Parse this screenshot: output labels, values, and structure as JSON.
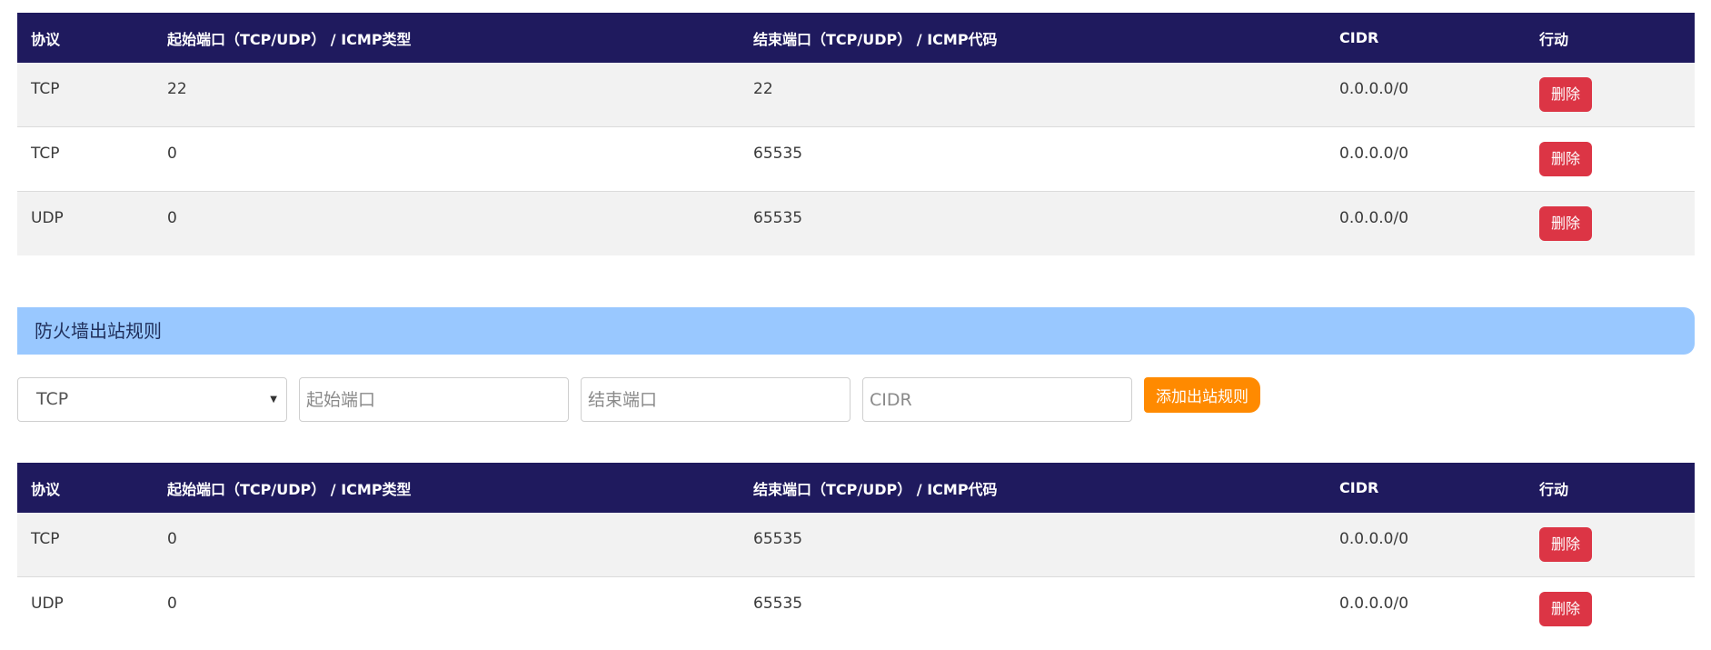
{
  "columns": [
    "协议",
    "起始端口（TCP/UDP） / ICMP类型",
    "结束端口（TCP/UDP） / ICMP代码",
    "CIDR",
    "行动"
  ],
  "inbound_rules": [
    {
      "protocol": "TCP",
      "start": "22",
      "end": "22",
      "cidr": "0.0.0.0/0",
      "action": "删除"
    },
    {
      "protocol": "TCP",
      "start": "0",
      "end": "65535",
      "cidr": "0.0.0.0/0",
      "action": "删除"
    },
    {
      "protocol": "UDP",
      "start": "0",
      "end": "65535",
      "cidr": "0.0.0.0/0",
      "action": "删除"
    }
  ],
  "outbound_section": {
    "title": "防火墙出站规则",
    "form": {
      "protocol_selected": "TCP",
      "start_placeholder": "起始端口",
      "end_placeholder": "结束端口",
      "cidr_placeholder": "CIDR",
      "add_label": "添加出站规则"
    }
  },
  "outbound_rules": [
    {
      "protocol": "TCP",
      "start": "0",
      "end": "65535",
      "cidr": "0.0.0.0/0",
      "action": "删除"
    },
    {
      "protocol": "UDP",
      "start": "0",
      "end": "65535",
      "cidr": "0.0.0.0/0",
      "action": "删除"
    }
  ],
  "colors": {
    "header_bg": "#1f1a5e",
    "delete_btn": "#dc3545",
    "add_btn": "#ff8a00",
    "section_bg": "#99c8ff"
  }
}
